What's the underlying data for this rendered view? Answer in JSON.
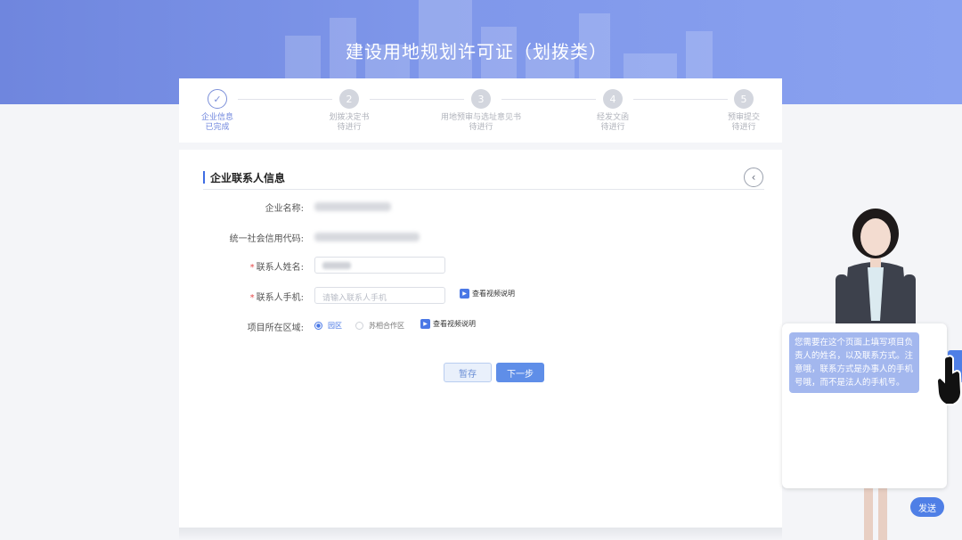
{
  "header": {
    "title": "建设用地规划许可证（划拨类）"
  },
  "steps": [
    {
      "index": "✓",
      "name": "企业信息",
      "status": "已完成"
    },
    {
      "index": "2",
      "name": "划拨决定书",
      "status": "待进行"
    },
    {
      "index": "3",
      "name": "用地预审与选址意见书",
      "status": "待进行"
    },
    {
      "index": "4",
      "name": "经发文函",
      "status": "待进行"
    },
    {
      "index": "5",
      "name": "预审提交",
      "status": "待进行"
    }
  ],
  "section": {
    "title": "企业联系人信息",
    "back_icon": "chevron-left-icon"
  },
  "form": {
    "company_name_label": "企业名称:",
    "credit_code_label": "统一社会信用代码:",
    "contact_name_label": "联系人姓名:",
    "contact_phone_label": "联系人手机:",
    "contact_phone_placeholder": "请输入联系人手机",
    "region_label": "项目所在区域:",
    "required_mark": "*",
    "video_link": "查看视频说明",
    "region_options": [
      "园区",
      "苏相合作区"
    ],
    "region_selected": "园区"
  },
  "buttons": {
    "save": "暂存",
    "next": "下一步"
  },
  "assistant": {
    "message": "您需要在这个页面上填写项目负责人的姓名，以及联系方式。注意哦，联系方式是办事人的手机号哦，而不是法人的手机号。",
    "send": "发送"
  },
  "colors": {
    "accent": "#4a78e6",
    "header": "#7b93e8",
    "required": "#e64a4a"
  }
}
